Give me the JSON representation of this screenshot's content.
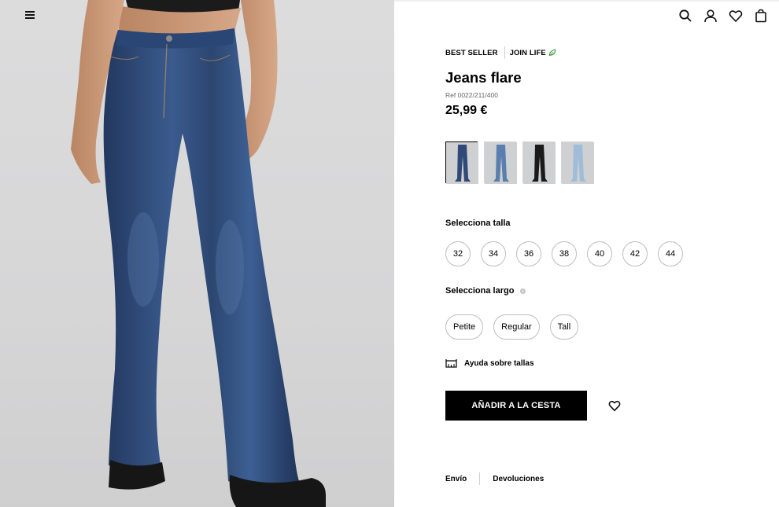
{
  "header": {
    "icons": [
      "menu-icon",
      "search-icon",
      "user-icon",
      "heart-icon",
      "bag-icon"
    ]
  },
  "product": {
    "badges": [
      "BEST SELLER",
      "JOIN LIFE"
    ],
    "title": "Jeans flare",
    "ref": "Ref 0022/211/400",
    "price": "25,99 €",
    "colors": [
      {
        "name": "dark-blue",
        "hex": "#2f4a78",
        "selected": true
      },
      {
        "name": "mid-blue",
        "hex": "#5a7fae",
        "selected": false
      },
      {
        "name": "black",
        "hex": "#1a1a1a",
        "selected": false
      },
      {
        "name": "light-blue",
        "hex": "#9fbcd8",
        "selected": false
      }
    ]
  },
  "size": {
    "label": "Selecciona talla",
    "options": [
      "32",
      "34",
      "36",
      "38",
      "40",
      "42",
      "44"
    ]
  },
  "length": {
    "label": "Selecciona largo",
    "options": [
      "Petite",
      "Regular",
      "Tall"
    ]
  },
  "help": {
    "label": "Ayuda sobre tallas"
  },
  "cart": {
    "add_label": "AÑADIR A LA CESTA"
  },
  "footer": {
    "links": [
      "Envío",
      "Devoluciones"
    ]
  },
  "colors": {
    "accent": "#000000",
    "leaf": "#3c9a3c",
    "denim": "#2f4f80"
  }
}
